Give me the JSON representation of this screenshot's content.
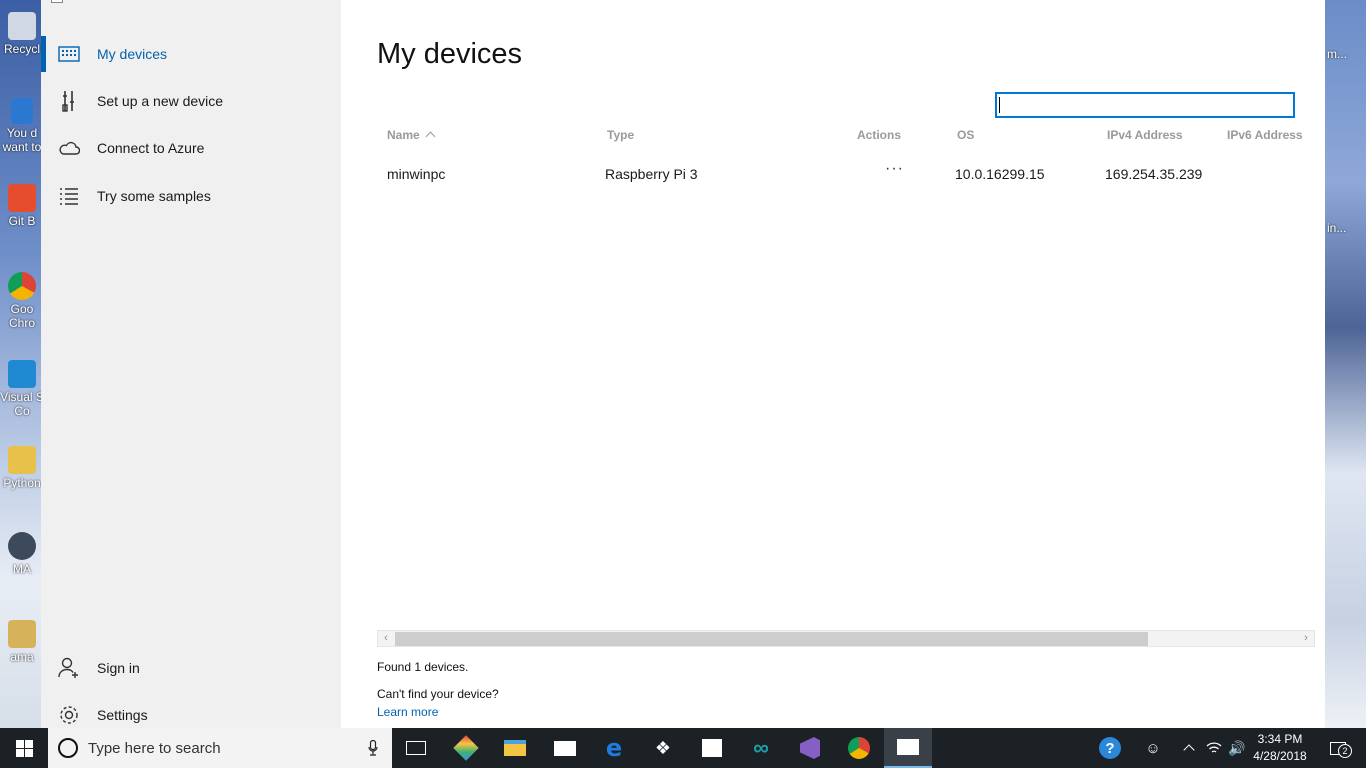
{
  "desktop": {
    "icons": [
      {
        "label": "Recycl"
      },
      {
        "label": "You d want to"
      },
      {
        "label": "Git B"
      },
      {
        "label": "Goo Chro"
      },
      {
        "label": "Visual S Co"
      },
      {
        "label": "Python"
      },
      {
        "label": "MA"
      },
      {
        "label": "ama"
      }
    ],
    "right_labels": [
      "m...",
      "in..."
    ]
  },
  "nav": {
    "items": [
      {
        "label": "My devices",
        "icon": "devices-icon",
        "active": true
      },
      {
        "label": "Set up a new device",
        "icon": "tools-icon"
      },
      {
        "label": "Connect to Azure",
        "icon": "cloud-icon"
      },
      {
        "label": "Try some samples",
        "icon": "list-icon"
      }
    ],
    "bottom": [
      {
        "label": "Sign in",
        "icon": "add-person-icon"
      },
      {
        "label": "Settings",
        "icon": "gear-icon"
      }
    ]
  },
  "main": {
    "title": "My devices",
    "search": {
      "value": "",
      "placeholder": ""
    },
    "columns": [
      "Name",
      "Type",
      "Actions",
      "OS",
      "IPv4 Address",
      "IPv6 Address"
    ],
    "sort_column": "Name",
    "sort_direction": "ascending",
    "rows": [
      {
        "name": "minwinpc",
        "type": "Raspberry Pi 3",
        "actions": "···",
        "os": "10.0.16299.15",
        "ipv4": "169.254.35.239",
        "ipv6": ""
      }
    ],
    "found_text": "Found 1 devices.",
    "cant_find_text": "Can't find your device?",
    "learn_more": "Learn more"
  },
  "taskbar": {
    "search_placeholder": "Type here to search",
    "time": "3:34 PM",
    "date": "4/28/2018",
    "notification_count": "2"
  },
  "colors": {
    "accent": "#0063b1",
    "nav_bg": "#f0f0f0",
    "taskbar_bg": "#1c2126"
  }
}
